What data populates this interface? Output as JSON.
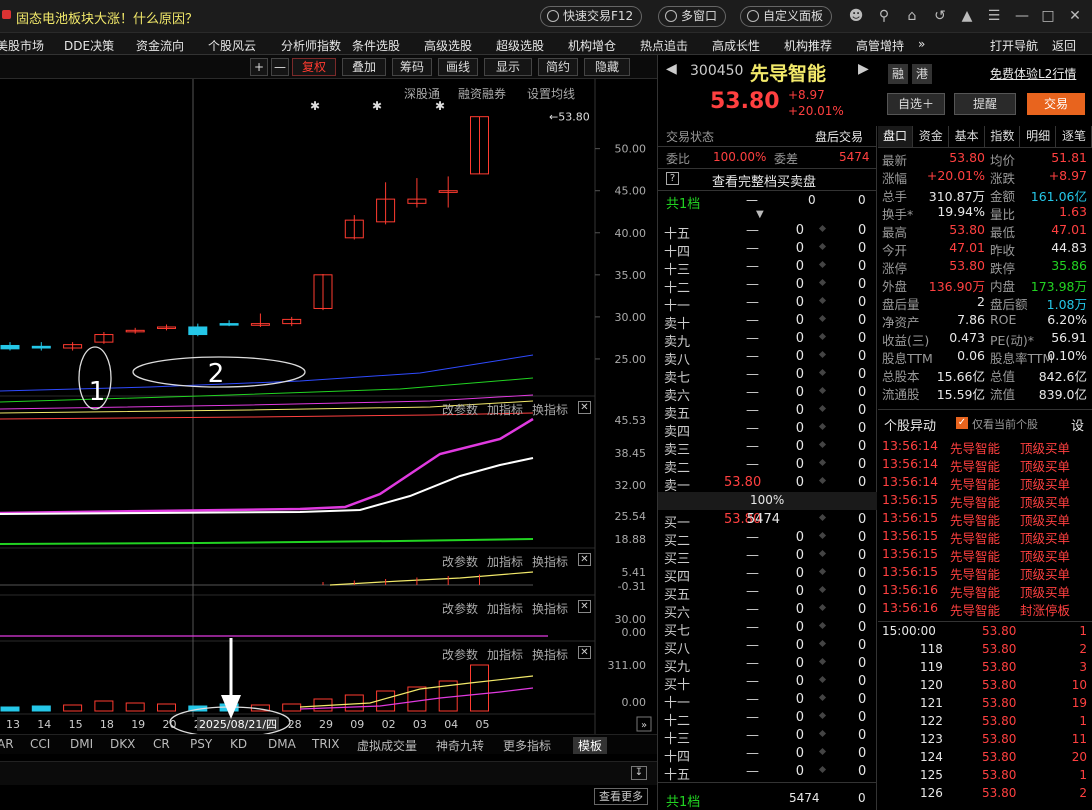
{
  "window": {
    "title": "固态电池板块大涨！什么原因？",
    "quick_trade": "快速交易F12",
    "multi_window": "多窗口",
    "custom_panel": "自定义面板"
  },
  "menu": [
    "美股市场",
    "DDE决策",
    "资金流向",
    "个股风云",
    "分析师指数",
    "条件选股",
    "高级选股",
    "超级选股",
    "机构增仓",
    "热点追击",
    "高成长性",
    "机构推荐",
    "高管增持",
    "»",
    "打开导航",
    "返回"
  ],
  "toolbar": {
    "plus": "+",
    "minus": "—",
    "fuquan": "复权",
    "diejia": "叠加",
    "chouma": "筹码",
    "huaxian": "画线",
    "xianshi": "显示",
    "jianyue": "简约",
    "yincang": "隐藏"
  },
  "chart_links": {
    "shengutong": "深股通",
    "rzrq": "融资融券",
    "ma_setting": "设置均线"
  },
  "chart_data": {
    "type": "bar",
    "title": "",
    "x": [
      "13",
      "14",
      "15",
      "18",
      "19",
      "20",
      "21",
      "26",
      "27",
      "28",
      "29",
      "09",
      "02",
      "03",
      "04",
      "05"
    ],
    "highlight_x": "2025/08/21/四",
    "price_axis": [
      "50.00",
      "45.00",
      "40.00",
      "35.00",
      "30.00",
      "25.00"
    ],
    "price_ylim": [
      20,
      54
    ],
    "candles": [
      {
        "o": 26.6,
        "c": 26.2,
        "h": 27.0,
        "l": 26.0,
        "up": false
      },
      {
        "o": 26.5,
        "c": 26.3,
        "h": 27.0,
        "l": 26.0,
        "up": false
      },
      {
        "o": 26.3,
        "c": 26.7,
        "h": 27.0,
        "l": 26.0,
        "up": true
      },
      {
        "o": 27.0,
        "c": 27.9,
        "h": 28.2,
        "l": 26.8,
        "up": true
      },
      {
        "o": 28.3,
        "c": 28.4,
        "h": 28.7,
        "l": 28.0,
        "up": true
      },
      {
        "o": 28.7,
        "c": 28.8,
        "h": 29.1,
        "l": 28.4,
        "up": true
      },
      {
        "o": 28.8,
        "c": 27.9,
        "h": 29.2,
        "l": 27.7,
        "up": false
      },
      {
        "o": 29.2,
        "c": 29.1,
        "h": 29.6,
        "l": 28.9,
        "up": false
      },
      {
        "o": 29.0,
        "c": 29.2,
        "h": 30.4,
        "l": 28.8,
        "up": true
      },
      {
        "o": 29.2,
        "c": 29.7,
        "h": 30.0,
        "l": 28.9,
        "up": true
      },
      {
        "o": 31.0,
        "c": 35.0,
        "h": 35.1,
        "l": 30.8,
        "up": true
      },
      {
        "o": 39.4,
        "c": 41.5,
        "h": 42.1,
        "l": 39.2,
        "up": true
      },
      {
        "o": 41.3,
        "c": 44.0,
        "h": 46.0,
        "l": 41.0,
        "up": true
      },
      {
        "o": 43.5,
        "c": 44.0,
        "h": 46.5,
        "l": 43.0,
        "up": true
      },
      {
        "o": 45.0,
        "c": 44.8,
        "h": 46.7,
        "l": 43.0,
        "up": true
      },
      {
        "o": 47.0,
        "c": 53.8,
        "h": 53.8,
        "l": 47.0,
        "up": true
      }
    ],
    "last_price_label": "53.80",
    "ind1_axis": [
      "45.53",
      "38.45",
      "32.00",
      "25.54",
      "18.88"
    ],
    "ind2_axis": [
      "5.41",
      "-0.31"
    ],
    "ind3_axis": [
      "30.00",
      "0.00"
    ],
    "ind4_axis": [
      "311.00",
      "0.00"
    ],
    "annotations": [
      "1",
      "2"
    ]
  },
  "indicator_panels": {
    "params": "改参数",
    "add": "加指标",
    "switch": "换指标"
  },
  "bottom_tabs": [
    "AR",
    "CCI",
    "DMI",
    "DKX",
    "CR",
    "PSY",
    "KD",
    "DMA",
    "TRIX",
    "虚拟成交量",
    "神奇九转",
    "更多指标",
    "模板"
  ],
  "more_btn": "查看更多",
  "stock": {
    "code": "300450",
    "name": "先导智能",
    "price": "53.80",
    "change": "+8.97",
    "pct": "+20.01%",
    "rong": "融",
    "gang": "港",
    "l2": "免费体验L2行情",
    "zixuan": "自选＋",
    "tixing": "提醒",
    "jiaoyi": "交易"
  },
  "status": {
    "label": "交易状态",
    "value": "盘后交易"
  },
  "weibi": {
    "l1": "委比",
    "v1": "100.00%",
    "l2": "委差",
    "v2": "5474"
  },
  "full_order_book": "查看完整档买卖盘",
  "gong1": {
    "label": "共1档",
    "v1": "—",
    "v2": "0",
    "v3": "0"
  },
  "ask_rows": [
    {
      "lbl": "十五",
      "p": "—",
      "v": "0",
      "c": "0"
    },
    {
      "lbl": "十四",
      "p": "—",
      "v": "0",
      "c": "0"
    },
    {
      "lbl": "十三",
      "p": "—",
      "v": "0",
      "c": "0"
    },
    {
      "lbl": "十二",
      "p": "—",
      "v": "0",
      "c": "0"
    },
    {
      "lbl": "十一",
      "p": "—",
      "v": "0",
      "c": "0"
    },
    {
      "lbl": "卖十",
      "p": "—",
      "v": "0",
      "c": "0"
    },
    {
      "lbl": "卖九",
      "p": "—",
      "v": "0",
      "c": "0"
    },
    {
      "lbl": "卖八",
      "p": "—",
      "v": "0",
      "c": "0"
    },
    {
      "lbl": "卖七",
      "p": "—",
      "v": "0",
      "c": "0"
    },
    {
      "lbl": "卖六",
      "p": "—",
      "v": "0",
      "c": "0"
    },
    {
      "lbl": "卖五",
      "p": "—",
      "v": "0",
      "c": "0"
    },
    {
      "lbl": "卖四",
      "p": "—",
      "v": "0",
      "c": "0"
    },
    {
      "lbl": "卖三",
      "p": "—",
      "v": "0",
      "c": "0"
    },
    {
      "lbl": "卖二",
      "p": "—",
      "v": "0",
      "c": "0"
    },
    {
      "lbl": "卖一",
      "p": "53.80",
      "v": "0",
      "c": "0"
    }
  ],
  "mid": "100%",
  "bid_rows": [
    {
      "lbl": "买一",
      "p": "53.80",
      "v": "5474",
      "c": "0"
    },
    {
      "lbl": "买二",
      "p": "—",
      "v": "0",
      "c": "0"
    },
    {
      "lbl": "买三",
      "p": "—",
      "v": "0",
      "c": "0"
    },
    {
      "lbl": "买四",
      "p": "—",
      "v": "0",
      "c": "0"
    },
    {
      "lbl": "买五",
      "p": "—",
      "v": "0",
      "c": "0"
    },
    {
      "lbl": "买六",
      "p": "—",
      "v": "0",
      "c": "0"
    },
    {
      "lbl": "买七",
      "p": "—",
      "v": "0",
      "c": "0"
    },
    {
      "lbl": "买八",
      "p": "—",
      "v": "0",
      "c": "0"
    },
    {
      "lbl": "买九",
      "p": "—",
      "v": "0",
      "c": "0"
    },
    {
      "lbl": "买十",
      "p": "—",
      "v": "0",
      "c": "0"
    },
    {
      "lbl": "十一",
      "p": "—",
      "v": "0",
      "c": "0"
    },
    {
      "lbl": "十二",
      "p": "—",
      "v": "0",
      "c": "0"
    },
    {
      "lbl": "十三",
      "p": "—",
      "v": "0",
      "c": "0"
    },
    {
      "lbl": "十四",
      "p": "—",
      "v": "0",
      "c": "0"
    },
    {
      "lbl": "十五",
      "p": "—",
      "v": "0",
      "c": "0"
    }
  ],
  "gong_bottom": {
    "label": "共1档",
    "v": "5474",
    "c": "0"
  },
  "info_tabs": [
    "盘口",
    "资金",
    "基本",
    "指数",
    "明细",
    "逐笔"
  ],
  "quote": [
    {
      "l": "最新",
      "v": "53.80",
      "vc": "red",
      "l2": "均价",
      "v2": "51.81",
      "v2c": "red"
    },
    {
      "l": "涨幅",
      "v": "+20.01%",
      "vc": "red",
      "l2": "涨跌",
      "v2": "+8.97",
      "v2c": "red"
    },
    {
      "l": "总手",
      "v": "310.87万",
      "vc": "wht",
      "l2": "金额",
      "v2": "161.06亿",
      "v2c": "cyan"
    },
    {
      "l": "换手*",
      "v": "19.94%",
      "vc": "wht",
      "l2": "量比",
      "v2": "1.63",
      "v2c": "red"
    },
    {
      "l": "最高",
      "v": "53.80",
      "vc": "red",
      "l2": "最低",
      "v2": "47.01",
      "v2c": "red"
    },
    {
      "l": "今开",
      "v": "47.01",
      "vc": "red",
      "l2": "昨收",
      "v2": "44.83",
      "v2c": "wht"
    },
    {
      "l": "涨停",
      "v": "53.80",
      "vc": "red",
      "l2": "跌停",
      "v2": "35.86",
      "v2c": "grn"
    },
    {
      "l": "外盘",
      "v": "136.90万",
      "vc": "red",
      "l2": "内盘",
      "v2": "173.98万",
      "v2c": "grn"
    },
    {
      "l": "盘后量",
      "v": "2",
      "vc": "wht",
      "l2": "盘后额",
      "v2": "1.08万",
      "v2c": "cyan"
    },
    {
      "l": "净资产",
      "v": "7.86",
      "vc": "wht",
      "l2": "ROE",
      "v2": "6.20%",
      "v2c": "wht"
    },
    {
      "l": "收益(三)",
      "v": "0.473",
      "vc": "wht",
      "l2": "PE(动)*",
      "v2": "56.91",
      "v2c": "wht"
    },
    {
      "l": "股息TTM",
      "v": "0.06",
      "vc": "wht",
      "l2": "股息率TTM",
      "v2": "0.10%",
      "v2c": "wht"
    },
    {
      "l": "总股本",
      "v": "15.66亿",
      "vc": "wht",
      "l2": "总值",
      "v2": "842.6亿",
      "v2c": "wht"
    },
    {
      "l": "流通股",
      "v": "15.59亿",
      "vc": "wht",
      "l2": "流值",
      "v2": "839.0亿",
      "v2c": "wht"
    }
  ],
  "alerts_header": {
    "title": "个股异动",
    "check": "仅看当前个股",
    "btn": "设"
  },
  "alerts": [
    {
      "t": "13:56:14",
      "n": "先导智能",
      "e": "顶级买单"
    },
    {
      "t": "13:56:14",
      "n": "先导智能",
      "e": "顶级买单"
    },
    {
      "t": "13:56:14",
      "n": "先导智能",
      "e": "顶级买单"
    },
    {
      "t": "13:56:15",
      "n": "先导智能",
      "e": "顶级买单"
    },
    {
      "t": "13:56:15",
      "n": "先导智能",
      "e": "顶级买单"
    },
    {
      "t": "13:56:15",
      "n": "先导智能",
      "e": "顶级买单"
    },
    {
      "t": "13:56:15",
      "n": "先导智能",
      "e": "顶级买单"
    },
    {
      "t": "13:56:15",
      "n": "先导智能",
      "e": "顶级买单"
    },
    {
      "t": "13:56:16",
      "n": "先导智能",
      "e": "顶级买单"
    },
    {
      "t": "13:56:16",
      "n": "先导智能",
      "e": "封涨停板"
    }
  ],
  "ticks": [
    {
      "t": "15:00:00",
      "p": "53.80",
      "v": "1"
    },
    {
      "t": "118",
      "p": "53.80",
      "v": "2"
    },
    {
      "t": "119",
      "p": "53.80",
      "v": "3"
    },
    {
      "t": "120",
      "p": "53.80",
      "v": "10"
    },
    {
      "t": "121",
      "p": "53.80",
      "v": "19"
    },
    {
      "t": "122",
      "p": "53.80",
      "v": "1"
    },
    {
      "t": "123",
      "p": "53.80",
      "v": "11"
    },
    {
      "t": "124",
      "p": "53.80",
      "v": "20"
    },
    {
      "t": "125",
      "p": "53.80",
      "v": "1"
    },
    {
      "t": "126",
      "p": "53.80",
      "v": "2"
    }
  ]
}
